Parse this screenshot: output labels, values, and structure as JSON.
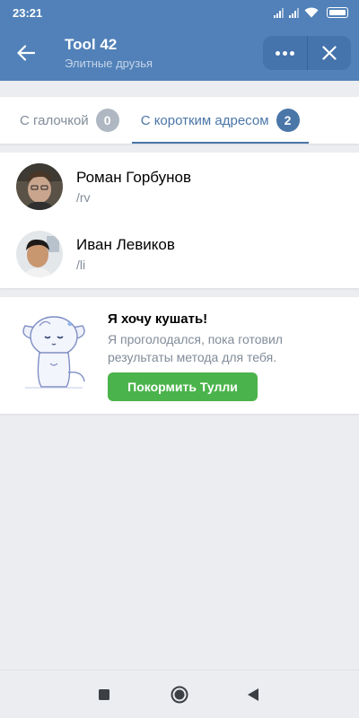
{
  "status_bar": {
    "time": "23:21"
  },
  "header": {
    "title": "Tool 42",
    "subtitle": "Элитные друзья",
    "accent": "#5181b8"
  },
  "tabs": [
    {
      "label": "С галочкой",
      "count": "0",
      "active": false
    },
    {
      "label": "С коротким адресом",
      "count": "2",
      "active": true
    }
  ],
  "friends": [
    {
      "name": "Роман Горбунов",
      "link": "/rv"
    },
    {
      "name": "Иван Левиков",
      "link": "/li"
    }
  ],
  "promo": {
    "title": "Я хочу кушать!",
    "text": "Я проголодался, пока готовил результаты метода для тебя.",
    "button": "Покормить Тулли",
    "button_color": "#4bb34b"
  }
}
